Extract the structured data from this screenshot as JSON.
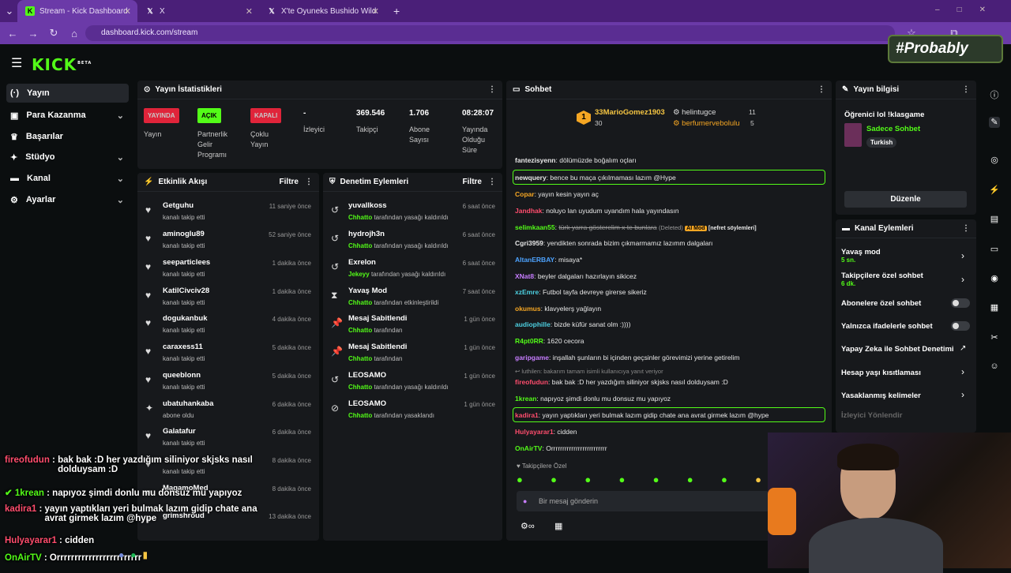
{
  "browser": {
    "tabs": [
      {
        "title": "Stream - Kick Dashboard",
        "active": true
      },
      {
        "title": "X"
      },
      {
        "title": "X'te Oyuneks Bushido Wildcats"
      }
    ],
    "url": "dashboard.kick.com/stream"
  },
  "brand": {
    "logo": "KICK",
    "beta": "BETA",
    "accent": "#53fc18"
  },
  "watermark": "#Probably",
  "sidebar": {
    "items": [
      {
        "label": "Yayın",
        "icon": "broadcast-icon"
      },
      {
        "label": "Para Kazanma",
        "icon": "money-icon"
      },
      {
        "label": "Başarılar",
        "icon": "trophy-icon"
      },
      {
        "label": "Stüdyo",
        "icon": "studio-icon"
      },
      {
        "label": "Kanal",
        "icon": "channel-icon"
      },
      {
        "label": "Ayarlar",
        "icon": "gear-icon"
      }
    ]
  },
  "stats": {
    "title": "Yayın İstatistikleri",
    "items": [
      {
        "badge": "YAYINDA",
        "label": "Yayın"
      },
      {
        "badge": "AÇIK",
        "label": "Partnerlik Gelir Programı"
      },
      {
        "badge": "KAPALI",
        "label": "Çoklu Yayın"
      },
      {
        "value": "-",
        "label": "İzleyici"
      },
      {
        "value": "369.546",
        "label": "Takipçi"
      },
      {
        "value": "1.706",
        "label": "Abone Sayısı"
      },
      {
        "value": "08:28:07",
        "label": "Yayında Olduğu Süre"
      }
    ]
  },
  "activity": {
    "title": "Etkinlik Akışı",
    "filter": "Filtre",
    "items": [
      {
        "name": "Getguhu",
        "sub": "kanalı takip etti",
        "time": "11 saniye önce"
      },
      {
        "name": "aminoglu89",
        "sub": "kanalı takip etti",
        "time": "52 saniye önce"
      },
      {
        "name": "seeparticlees",
        "sub": "kanalı takip etti",
        "time": "1 dakika önce"
      },
      {
        "name": "KatilCivciv28",
        "sub": "kanalı takip etti",
        "time": "1 dakika önce"
      },
      {
        "name": "dogukanbuk",
        "sub": "kanalı takip etti",
        "time": "4 dakika önce"
      },
      {
        "name": "caraxess11",
        "sub": "kanalı takip etti",
        "time": "5 dakika önce"
      },
      {
        "name": "queeblonn",
        "sub": "kanalı takip etti",
        "time": "5 dakika önce"
      },
      {
        "name": "ubatuhankaba",
        "sub": "abone oldu",
        "time": "6 dakika önce"
      },
      {
        "name": "Galatafur",
        "sub": "kanalı takip etti",
        "time": "6 dakika önce"
      },
      {
        "name": "",
        "sub": "kanalı takip etti",
        "time": "8 dakika önce"
      },
      {
        "name": "MagamoMed",
        "sub": "",
        "time": "8 dakika önce"
      },
      {
        "name": "grimshroud",
        "sub": "",
        "time": "13 dakika önce"
      }
    ]
  },
  "moderation": {
    "title": "Denetim Eylemleri",
    "filter": "Filtre",
    "items": [
      {
        "name": "yuvallkoss",
        "by": "Chhatto",
        "sub": "tarafından yasağı kaldırıldı",
        "time": "6 saat önce"
      },
      {
        "name": "hydrojh3n",
        "by": "Chhatto",
        "sub": "tarafından yasağı kaldırıldı",
        "time": "6 saat önce"
      },
      {
        "name": "Exrelon",
        "by": "Jekeyy",
        "sub": "tarafından yasağı kaldırıldı",
        "time": "6 saat önce"
      },
      {
        "name": "Yavaş Mod",
        "by": "Chhatto",
        "sub": "tarafından etkinleştirildi",
        "time": "7 saat önce"
      },
      {
        "name": "Mesaj Sabitlendi",
        "by": "Chhatto",
        "sub": "tarafından",
        "time": "1 gün önce"
      },
      {
        "name": "Mesaj Sabitlendi",
        "by": "Chhatto",
        "sub": "tarafından",
        "time": "1 gün önce"
      },
      {
        "name": "LEOSAMO",
        "by": "Chhatto",
        "sub": "tarafından yasağı kaldırıldı",
        "time": "1 gün önce"
      },
      {
        "name": "LEOSAMO",
        "by": "Chhatto",
        "sub": "tarafından yasaklandı",
        "time": "1 gün önce"
      }
    ]
  },
  "chat": {
    "title": "Sohbet",
    "top_gifters": [
      {
        "rank": "1",
        "name": "33MarioGomez1903",
        "count": "30"
      },
      {
        "name": "helintugce",
        "count": "11"
      },
      {
        "name": "berfumervebolulu",
        "count": "5"
      }
    ],
    "messages": [
      {
        "user": "fantezisyenn",
        "color": "#e8e8e8",
        "text": "dölümüzde boğalım oçları"
      },
      {
        "user": "newquery",
        "color": "#e8e8e8",
        "text": "bence bu maça çıkılmaması lazım @Hype",
        "highlight": true
      },
      {
        "user": "Copar",
        "color": "#f5a623",
        "text": "yayın kesin yayın aç"
      },
      {
        "user": "Jandhak",
        "color": "#ff4d6d",
        "text": "noluyo lan uyudum uyandım hala yayındasın"
      },
      {
        "user": "selimkaan55",
        "color": "#53fc18",
        "text": "türk yarra gösterelim x te bunlara",
        "deleted": "(Deleted)",
        "tag": "AI Mod",
        "reason": "[nefret söylemleri]"
      },
      {
        "user": "Cgri3959",
        "color": "#e8e8e8",
        "text": "yendikten sonrada bizim çıkmarmamız lazımm dalgaları"
      },
      {
        "user": "AltanERBAY",
        "color": "#4da3ff",
        "text": "misaya*"
      },
      {
        "user": "XNat8",
        "color": "#c77dff",
        "text": "beyler dalgaları hazırlayın sikicez"
      },
      {
        "user": "xzEmre",
        "color": "#4dd0e1",
        "text": "Futbol tayfa devreye girerse sikeriz"
      },
      {
        "user": "okumus",
        "color": "#f5a623",
        "text": "klavyelerş yağlayın"
      },
      {
        "user": "audiophille",
        "color": "#4dd0e1",
        "text": "bizde küfür sanat olm :))))"
      },
      {
        "user": "R4pt0RR",
        "color": "#53fc18",
        "text": "1620 cecora"
      },
      {
        "user": "garipgame",
        "color": "#c77dff",
        "text": "inşallah şunların bi içinden geçsinler görevimizi yerine getirelim"
      },
      {
        "user": "fireofudun",
        "color": "#ff4d6d",
        "text": "bak bak :D her yazdığım siliniyor skjsks nasıl dolduysam :D",
        "reply": "luthilen: bakarım tamam isimli kullanıcıya yanıt veriyor"
      },
      {
        "user": "1krean",
        "color": "#53fc18",
        "text": "napıyoz şimdi donlu mu donsuz mu yapıyoz"
      },
      {
        "user": "kadira1",
        "color": "#ff4d6d",
        "text": "yayın yaptıkları yeri bulmak lazım gidip chate ana avrat girmek lazım @hype",
        "highlight": true
      },
      {
        "user": "Hulyayarar1",
        "color": "#ff4d6d",
        "text": "cidden"
      },
      {
        "user": "OnAirTV",
        "color": "#53fc18",
        "text": "Orrrrrrrrrrrrrrrrrrrrrrrrr"
      }
    ],
    "followers_only": "Takipçilere Özel",
    "placeholder": "Bir mesaj gönderin"
  },
  "stream_info": {
    "title": "Yayın bilgisi",
    "stream_title": "Öğrenici lol !klasgame",
    "category": "Sadece Sohbet",
    "language": "Turkish",
    "edit": "Düzenle"
  },
  "channel_actions": {
    "title": "Kanal Eylemleri",
    "items": [
      {
        "label": "Yavaş mod",
        "sub": "5 sn.",
        "type": "chevron"
      },
      {
        "label": "Takipçilere özel sohbet",
        "sub": "6 dk.",
        "type": "chevron"
      },
      {
        "label": "Abonelere özel sohbet",
        "type": "toggle"
      },
      {
        "label": "Yalnızca ifadelerle sohbet",
        "type": "toggle"
      },
      {
        "label": "Yapay Zeka ile Sohbet Denetimi",
        "type": "external"
      },
      {
        "label": "Hesap yaşı kısıtlaması",
        "type": "chevron"
      },
      {
        "label": "Yasaklanmış kelimeler",
        "type": "chevron"
      },
      {
        "label": "İzleyici Yönlendir",
        "type": "chevron"
      }
    ]
  },
  "overlay_chat": [
    {
      "user": "fireofudun",
      "text": "bak bak :D her yazdığım siliniyor skjsks nasıl dolduysam :D"
    },
    {
      "user": "1krean",
      "text": "napıyoz şimdi donlu mu donsuz mu yapıyoz"
    },
    {
      "user": "kadira1",
      "text": "yayın yaptıkları yeri bulmak lazım gidip chate ana avrat girmek lazım @hype"
    },
    {
      "user": "Hulyayarar1",
      "text": "cidden"
    },
    {
      "user": "OnAirTV",
      "text": "Orrrrrrrrrrrrrrrrrrrrrrrr"
    }
  ]
}
